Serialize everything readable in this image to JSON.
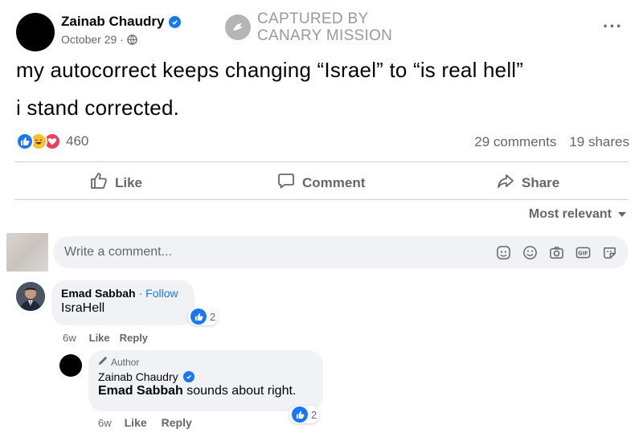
{
  "post": {
    "author": "Zainab Chaudry",
    "date": "October 29 ·",
    "text_line1": "my autocorrect keeps changing “Israel” to “is real hell”",
    "text_line2": "i stand corrected.",
    "reaction_count": "460",
    "comments_count": "29 comments",
    "shares_count": "19 shares"
  },
  "watermark": {
    "line1": "CAPTURED BY",
    "line2": "CANARY MISSION"
  },
  "more_label": "···",
  "actions": {
    "like": "Like",
    "comment": "Comment",
    "share": "Share"
  },
  "sort_label": "Most relevant",
  "comment_box": {
    "placeholder": "Write a comment..."
  },
  "comments": [
    {
      "name": "Emad Sabbah",
      "follow": "· Follow",
      "text": "IsraHell",
      "likes": "2",
      "age": "6w",
      "like_label": "Like",
      "reply_label": "Reply"
    }
  ],
  "reply": {
    "badge": "Author",
    "name": "Zainab Chaudry",
    "mention": "Emad Sabbah",
    "text": " sounds about right.",
    "likes": "2",
    "age": "6w",
    "like_label": "Like",
    "reply_label": "Reply"
  },
  "colors": {
    "brand_blue": "#1877f2",
    "secondary_text": "#65676b",
    "bubble_bg": "#f0f2f5"
  },
  "icons": [
    "verified-icon",
    "globe-icon",
    "more-icon",
    "like-icon",
    "comment-icon",
    "share-icon",
    "chevron-down-icon",
    "sticker-icon",
    "emoji-icon",
    "camera-icon",
    "gif-icon",
    "avatar-sticker-icon",
    "pencil-icon"
  ]
}
